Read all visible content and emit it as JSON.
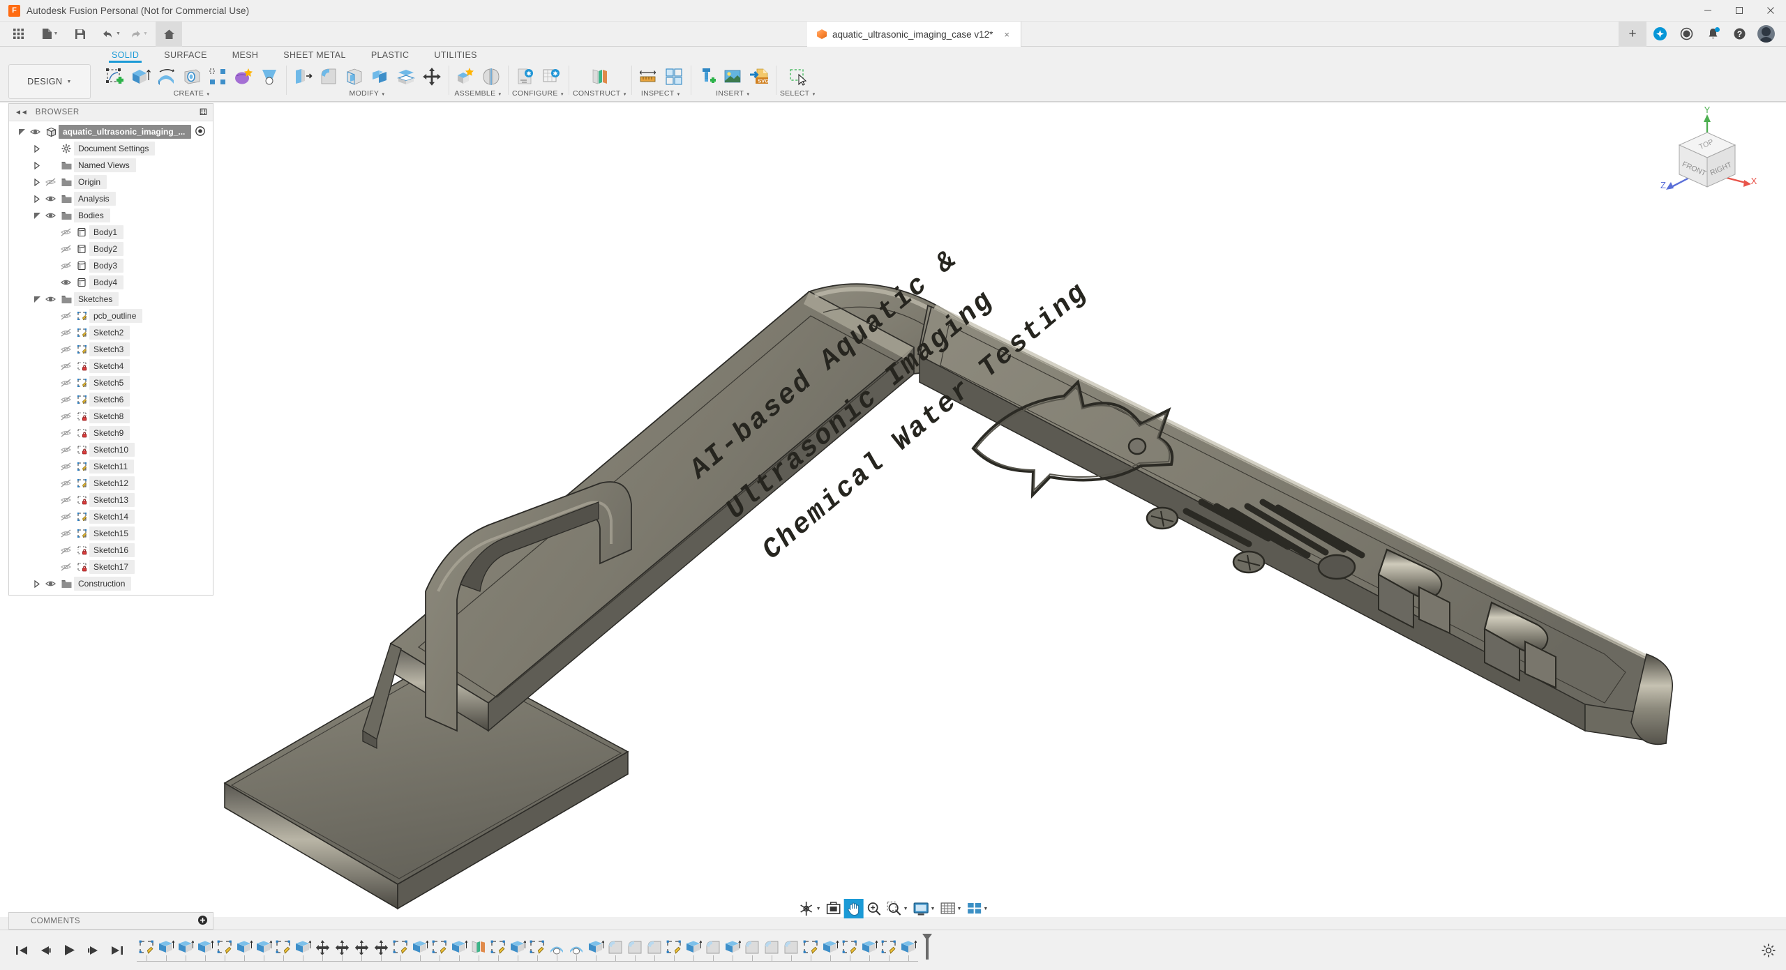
{
  "window": {
    "title": "Autodesk Fusion Personal (Not for Commercial Use)",
    "logo_letter": "F",
    "minimize": "–",
    "maximize": "☐",
    "close": "×"
  },
  "quick_access": {
    "grid_icon": "app-grid-icon",
    "new_icon": "new-document-icon",
    "save_icon": "save-icon",
    "undo_icon": "undo-icon",
    "redo_icon": "redo-icon",
    "home_icon": "home-icon",
    "caret": "▼"
  },
  "document_tab": {
    "label": "aquatic_ultrasonic_imaging_case v12*",
    "close": "×",
    "new_tab": "+"
  },
  "account_bar": {
    "extensions_icon": "extensions-icon",
    "jobs_icon": "job-status-clock-icon",
    "notifications_icon": "notifications-bell-icon",
    "help_icon": "help-question-icon",
    "avatar_icon": "user-avatar-icon",
    "help_glyph": "?"
  },
  "ribbon": {
    "workspace": "DESIGN",
    "workspace_caret": "▼",
    "tabs": [
      {
        "label": "SOLID",
        "active": true
      },
      {
        "label": "SURFACE",
        "active": false
      },
      {
        "label": "MESH",
        "active": false
      },
      {
        "label": "SHEET METAL",
        "active": false
      },
      {
        "label": "PLASTIC",
        "active": false
      },
      {
        "label": "UTILITIES",
        "active": false
      }
    ],
    "panels": [
      {
        "label": "CREATE",
        "caret": "▼",
        "icons": [
          "create-sketch-icon",
          "extrude-icon",
          "revolve-icon",
          "sweep-icon",
          "pattern-icon",
          "create-form-icon",
          "loft-icon"
        ]
      },
      {
        "label": "MODIFY",
        "caret": "▼",
        "icons": [
          "press-pull-icon",
          "fillet-icon",
          "shell-icon",
          "combine-icon",
          "offset-face-icon",
          "move-copy-icon"
        ]
      },
      {
        "label": "ASSEMBLE",
        "caret": "▼",
        "icons": [
          "new-component-icon",
          "joint-icon"
        ]
      },
      {
        "label": "CONFIGURE",
        "caret": "▼",
        "icons": [
          "configure-design-icon",
          "configure-table-icon"
        ]
      },
      {
        "label": "CONSTRUCT",
        "caret": "▼",
        "icons": [
          "offset-plane-icon"
        ]
      },
      {
        "label": "INSPECT",
        "caret": "▼",
        "icons": [
          "measure-icon",
          "section-analysis-icon"
        ]
      },
      {
        "label": "INSERT",
        "caret": "▼",
        "icons": [
          "insert-mcmaster-icon",
          "insert-decal-icon",
          "insert-svg-icon"
        ]
      },
      {
        "label": "SELECT",
        "caret": "▼",
        "icons": [
          "select-window-icon"
        ]
      }
    ]
  },
  "browser": {
    "title": "BROWSER",
    "collapse_icon": "collapse-left-icon",
    "minimize_icon": "panel-minimize-icon",
    "items": [
      {
        "label": "aquatic_ultrasonic_imaging_...",
        "indent": 0,
        "chev": "open",
        "eye": "visible",
        "icon": "component-icon",
        "selected": true,
        "activate_dot": true
      },
      {
        "label": "Document Settings",
        "indent": 1,
        "chev": "closed",
        "eye": "none",
        "icon": "gear-icon",
        "selected": false
      },
      {
        "label": "Named Views",
        "indent": 1,
        "chev": "closed",
        "eye": "none",
        "icon": "folder-icon",
        "selected": false
      },
      {
        "label": "Origin",
        "indent": 1,
        "chev": "closed",
        "eye": "hidden",
        "icon": "folder-icon",
        "selected": false
      },
      {
        "label": "Analysis",
        "indent": 1,
        "chev": "closed",
        "eye": "visible",
        "icon": "folder-icon",
        "selected": false
      },
      {
        "label": "Bodies",
        "indent": 1,
        "chev": "open",
        "eye": "visible",
        "icon": "folder-icon",
        "selected": false
      },
      {
        "label": "Body1",
        "indent": 2,
        "chev": "none",
        "eye": "hidden",
        "icon": "body-icon",
        "selected": false
      },
      {
        "label": "Body2",
        "indent": 2,
        "chev": "none",
        "eye": "hidden",
        "icon": "body-icon",
        "selected": false
      },
      {
        "label": "Body3",
        "indent": 2,
        "chev": "none",
        "eye": "hidden",
        "icon": "body-icon",
        "selected": false
      },
      {
        "label": "Body4",
        "indent": 2,
        "chev": "none",
        "eye": "visible",
        "icon": "body-icon",
        "selected": false
      },
      {
        "label": "Sketches",
        "indent": 1,
        "chev": "open",
        "eye": "visible",
        "icon": "folder-icon",
        "selected": false
      },
      {
        "label": "pcb_outline",
        "indent": 2,
        "chev": "none",
        "eye": "hidden",
        "icon": "sketch-icon",
        "selected": false
      },
      {
        "label": "Sketch2",
        "indent": 2,
        "chev": "none",
        "eye": "hidden",
        "icon": "sketch-icon",
        "selected": false
      },
      {
        "label": "Sketch3",
        "indent": 2,
        "chev": "none",
        "eye": "hidden",
        "icon": "sketch-icon",
        "selected": false
      },
      {
        "label": "Sketch4",
        "indent": 2,
        "chev": "none",
        "eye": "hidden",
        "icon": "sketch-locked-icon",
        "selected": false
      },
      {
        "label": "Sketch5",
        "indent": 2,
        "chev": "none",
        "eye": "hidden",
        "icon": "sketch-icon",
        "selected": false
      },
      {
        "label": "Sketch6",
        "indent": 2,
        "chev": "none",
        "eye": "hidden",
        "icon": "sketch-icon",
        "selected": false
      },
      {
        "label": "Sketch8",
        "indent": 2,
        "chev": "none",
        "eye": "hidden",
        "icon": "sketch-locked-icon",
        "selected": false
      },
      {
        "label": "Sketch9",
        "indent": 2,
        "chev": "none",
        "eye": "hidden",
        "icon": "sketch-locked-icon",
        "selected": false
      },
      {
        "label": "Sketch10",
        "indent": 2,
        "chev": "none",
        "eye": "hidden",
        "icon": "sketch-locked-icon",
        "selected": false
      },
      {
        "label": "Sketch11",
        "indent": 2,
        "chev": "none",
        "eye": "hidden",
        "icon": "sketch-icon",
        "selected": false
      },
      {
        "label": "Sketch12",
        "indent": 2,
        "chev": "none",
        "eye": "hidden",
        "icon": "sketch-icon",
        "selected": false
      },
      {
        "label": "Sketch13",
        "indent": 2,
        "chev": "none",
        "eye": "hidden",
        "icon": "sketch-locked-icon",
        "selected": false
      },
      {
        "label": "Sketch14",
        "indent": 2,
        "chev": "none",
        "eye": "hidden",
        "icon": "sketch-icon",
        "selected": false
      },
      {
        "label": "Sketch15",
        "indent": 2,
        "chev": "none",
        "eye": "hidden",
        "icon": "sketch-icon",
        "selected": false
      },
      {
        "label": "Sketch16",
        "indent": 2,
        "chev": "none",
        "eye": "hidden",
        "icon": "sketch-locked-icon",
        "selected": false
      },
      {
        "label": "Sketch17",
        "indent": 2,
        "chev": "none",
        "eye": "hidden",
        "icon": "sketch-locked-icon",
        "selected": false
      },
      {
        "label": "Construction",
        "indent": 1,
        "chev": "closed",
        "eye": "visible",
        "icon": "folder-icon",
        "selected": false
      }
    ]
  },
  "canvas": {
    "background": "#ffffff",
    "model_name": "aquatic_ultrasonic_imaging_case",
    "engraved_text": [
      "AI-based Aquatic &",
      "Ultrasonic Imaging",
      "Chemical Water Testing"
    ],
    "engraved_graphic": "fish-silhouette-icon",
    "body_color": "#7d7a6e",
    "body_highlight": "#b5b1a2",
    "body_shadow": "#4e4c44",
    "edge_color": "#2b2b28",
    "features": [
      "vent-slots",
      "screw-bosses",
      "cable-port",
      "hinge-barrels",
      "handle-bracket",
      "base-plate"
    ]
  },
  "viewcube": {
    "faces": {
      "top": "TOP",
      "front": "FRONT",
      "right": "RIGHT"
    },
    "axes": [
      {
        "label": "X",
        "color": "#e8544a"
      },
      {
        "label": "Y",
        "color": "#4caf50"
      },
      {
        "label": "Z",
        "color": "#5a6fd8"
      }
    ]
  },
  "navbar": {
    "items": [
      {
        "name": "orbit-icon",
        "caret": true,
        "active": false
      },
      {
        "name": "look-at-icon",
        "caret": false,
        "active": false
      },
      {
        "name": "pan-hand-icon",
        "caret": false,
        "active": true
      },
      {
        "name": "zoom-icon",
        "caret": false,
        "active": false
      },
      {
        "name": "fit-to-window-icon",
        "caret": true,
        "active": false
      },
      {
        "name": "display-settings-icon",
        "caret": true,
        "active": false
      },
      {
        "name": "grid-snaps-icon",
        "caret": true,
        "active": false
      },
      {
        "name": "viewports-icon",
        "caret": true,
        "active": false
      }
    ],
    "caret": "▼"
  },
  "comments": {
    "title": "COMMENTS",
    "expand": "⊕",
    "expand_icon": "comments-expand-icon"
  },
  "timeline": {
    "playback": [
      {
        "name": "go-to-beginning-icon",
        "glyph": "⏮"
      },
      {
        "name": "step-back-icon",
        "glyph": "◀"
      },
      {
        "name": "play-icon",
        "glyph": "▶"
      },
      {
        "name": "step-forward-icon",
        "glyph": "▶"
      },
      {
        "name": "go-to-end-icon",
        "glyph": "⏭"
      }
    ],
    "features": [
      "sketch-feature",
      "extrude-feature",
      "extrude-feature",
      "extrude-feature",
      "sketch-feature",
      "extrude-feature",
      "extrude-feature",
      "sketch-feature",
      "extrude-feature",
      "move-feature",
      "move-feature",
      "move-feature",
      "move-feature",
      "sketch-feature",
      "extrude-feature",
      "sketch-feature",
      "extrude-feature",
      "plane-feature",
      "sketch-feature",
      "extrude-feature",
      "sketch-feature",
      "revolve-feature",
      "revolve-feature",
      "extrude-feature",
      "fillet-feature",
      "fillet-feature",
      "fillet-feature",
      "sketch-feature",
      "extrude-feature",
      "fillet-feature",
      "extrude-feature",
      "fillet-feature",
      "fillet-feature",
      "fillet-feature",
      "sketch-feature",
      "extrude-feature",
      "sketch-feature",
      "extrude-feature",
      "sketch-feature",
      "extrude-feature"
    ],
    "marker_icon": "timeline-end-marker-icon",
    "settings_icon": "timeline-settings-icon"
  }
}
